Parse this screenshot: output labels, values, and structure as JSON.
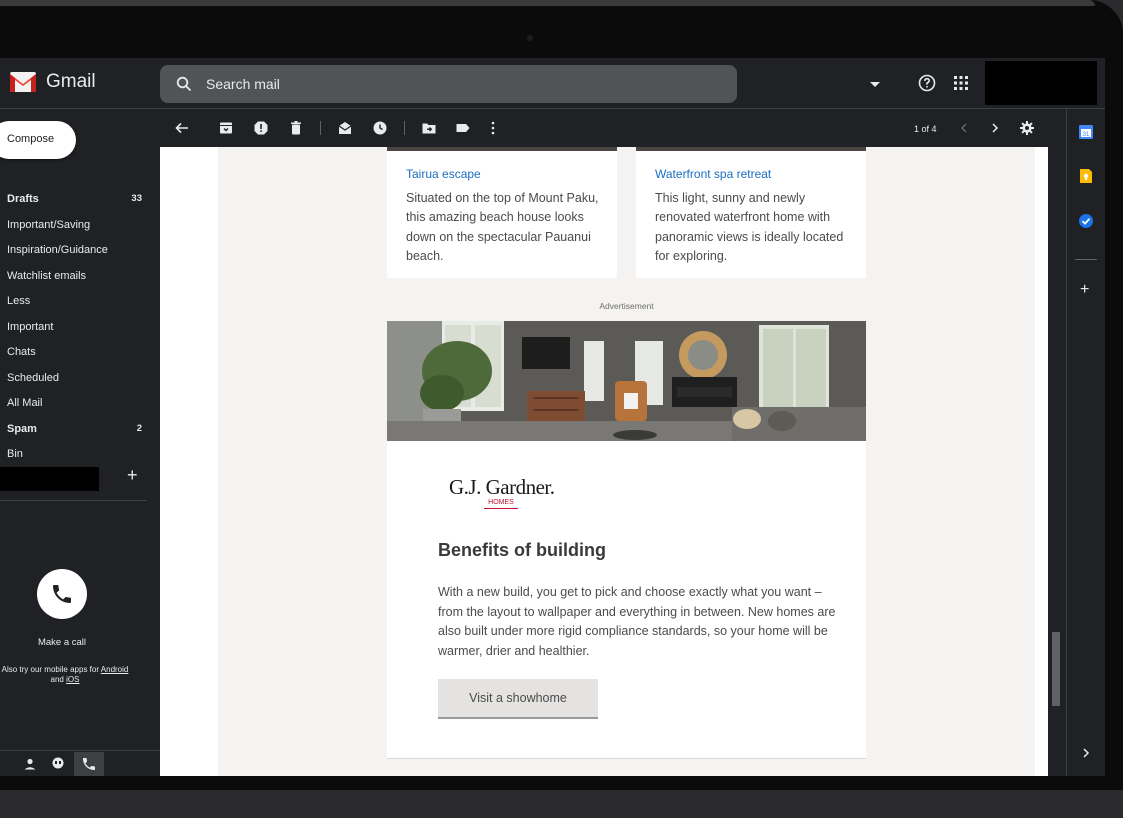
{
  "header": {
    "app_name": "Gmail",
    "search_placeholder": "Search mail"
  },
  "sidebar": {
    "compose_label": "Compose",
    "items": [
      {
        "label": "Drafts",
        "count": "33",
        "bold": true
      },
      {
        "label": "Important/Saving",
        "count": ""
      },
      {
        "label": "Inspiration/Guidance",
        "count": ""
      },
      {
        "label": "Watchlist emails",
        "count": ""
      },
      {
        "label": "Less",
        "count": ""
      },
      {
        "label": "Important",
        "count": ""
      },
      {
        "label": "Chats",
        "count": ""
      },
      {
        "label": "Scheduled",
        "count": ""
      },
      {
        "label": "All Mail",
        "count": ""
      },
      {
        "label": "Spam",
        "count": "2",
        "bold": true
      },
      {
        "label": "Bin",
        "count": ""
      }
    ],
    "labels_add": "+",
    "make_call": "Make a call",
    "mobile_note_prefix": "Also try our mobile apps for",
    "android_link": "Android",
    "and_text": "and",
    "ios_link": "iOS"
  },
  "toolbar": {
    "pager": "1 of 4"
  },
  "email": {
    "cards": [
      {
        "title": "Tairua escape",
        "text": "Situated on the top of Mount Paku, this amazing beach house looks down on the spectacular Pauanui beach."
      },
      {
        "title": "Waterfront spa retreat",
        "text": "This light, sunny and newly renovated waterfront home with panoramic views is ideally located for exploring."
      }
    ],
    "ad_label": "Advertisement",
    "brand_name": "G.J. Gardner.",
    "brand_sub": "HOMES",
    "ad_heading": "Benefits of building",
    "ad_text": "With a new build, you get to pick and choose exactly what you want – from the layout to wallpaper and everything in between. New homes are also built under more rigid compliance standards, so your home will be warmer, drier and healthier.",
    "ad_button": "Visit a showhome"
  },
  "colors": {
    "gmail_red": "#ea4335",
    "link_blue": "#1b6ec2",
    "dark_bg": "#202124",
    "brand_red": "#c8102e"
  },
  "side_panel": {
    "calendar_day": "31",
    "add": "+"
  }
}
